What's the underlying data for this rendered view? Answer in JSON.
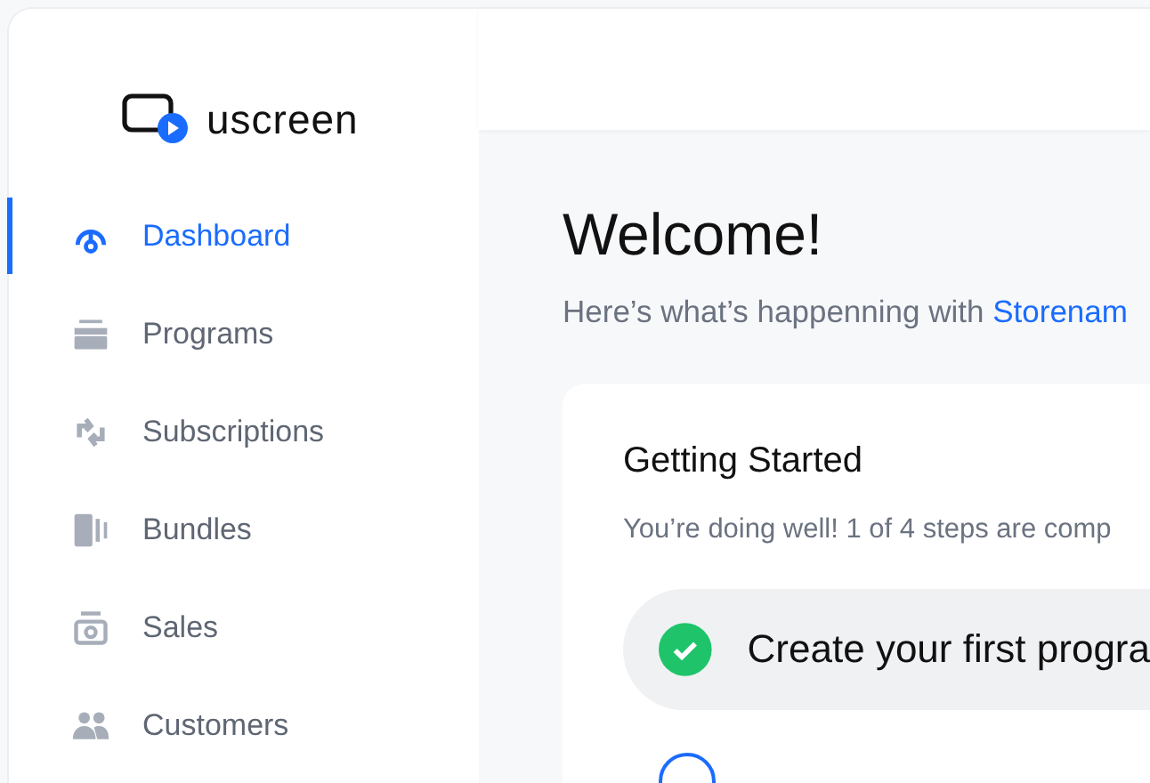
{
  "brand": {
    "name": "uscreen"
  },
  "nav": [
    {
      "label": "Dashboard",
      "kind": "dashboard",
      "selected": true
    },
    {
      "label": "Programs",
      "kind": "programs",
      "selected": false
    },
    {
      "label": "Subscriptions",
      "kind": "subscriptions",
      "selected": false
    },
    {
      "label": "Bundles",
      "kind": "bundles",
      "selected": false
    },
    {
      "label": "Sales",
      "kind": "sales",
      "selected": false
    },
    {
      "label": "Customers",
      "kind": "customers",
      "selected": false
    }
  ],
  "welcome": {
    "title": "Welcome!",
    "subtitle": "Here’s what’s happenning with",
    "store": "Storenam"
  },
  "getting_started": {
    "title": "Getting Started",
    "progress": "You’re doing well! 1 of 4 steps are comp",
    "steps": [
      {
        "label": "Create your first progra",
        "completed": true
      },
      {
        "completed": false
      }
    ]
  }
}
